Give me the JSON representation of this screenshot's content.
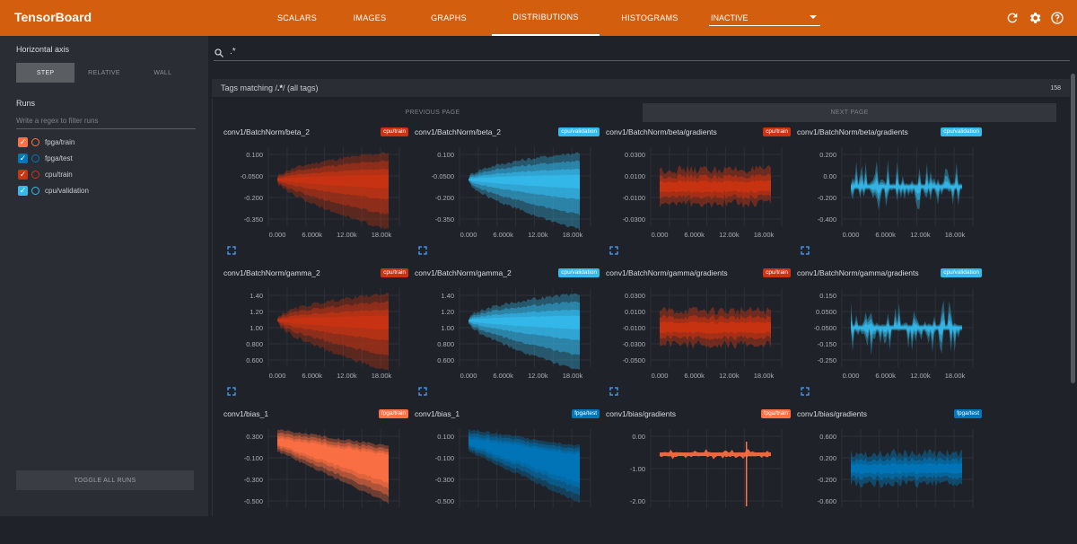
{
  "brand": "TensorBoard",
  "tabs": [
    {
      "label": "SCALARS",
      "active": false
    },
    {
      "label": "IMAGES",
      "active": false
    },
    {
      "label": "GRAPHS",
      "active": false
    },
    {
      "label": "DISTRIBUTIONS",
      "active": true
    },
    {
      "label": "HISTOGRAMS",
      "active": false
    }
  ],
  "inactive_select": "INACTIVE",
  "icons": {
    "refresh": "refresh-icon",
    "settings": "gear-icon",
    "help": "help-icon"
  },
  "sidebar": {
    "horizontal_axis_title": "Horizontal axis",
    "axis_options": [
      {
        "label": "STEP",
        "active": true
      },
      {
        "label": "RELATIVE",
        "active": false
      },
      {
        "label": "WALL",
        "active": false
      }
    ],
    "runs_title": "Runs",
    "filter_placeholder": "Write a regex to filter runs",
    "runs": [
      {
        "name": "fpga/train",
        "color": "#ff7043"
      },
      {
        "name": "fpga/test",
        "color": "#0077bb"
      },
      {
        "name": "cpu/train",
        "color": "#cc3311"
      },
      {
        "name": "cpu/validation",
        "color": "#33bbee"
      }
    ],
    "toggle_all": "TOGGLE ALL RUNS"
  },
  "search": {
    "value": ".*"
  },
  "tags": {
    "label_prefix": "Tags matching /",
    "regex": ".*",
    "label_suffix": "/ (all tags)",
    "count": "158"
  },
  "pager": {
    "previous": "PREVIOUS PAGE",
    "next": "NEXT PAGE"
  },
  "colors": {
    "cpu_train": "#cc3311",
    "cpu_validation": "#33bbee",
    "fpga_train": "#ff7043",
    "fpga_test": "#0077bb"
  },
  "cards": [
    {
      "title": "conv1/BatchNorm/beta_2",
      "run": "cpu/train",
      "color": "#cc3311",
      "kind": "fan",
      "yticks": [
        "0.100",
        "-0.0500",
        "-0.200",
        "-0.350"
      ],
      "xticks": [
        "0.000",
        "6.000k",
        "12.00k",
        "18.00k"
      ]
    },
    {
      "title": "conv1/BatchNorm/beta_2",
      "run": "cpu/validation",
      "color": "#33bbee",
      "kind": "fan",
      "yticks": [
        "0.100",
        "-0.0500",
        "-0.200",
        "-0.350"
      ],
      "xticks": [
        "0.000",
        "6.000k",
        "12.00k",
        "18.00k"
      ]
    },
    {
      "title": "conv1/BatchNorm/beta/gradients",
      "run": "cpu/train",
      "color": "#cc3311",
      "kind": "noise",
      "yticks": [
        "0.0300",
        "0.0100",
        "-0.0100",
        "-0.0300"
      ],
      "xticks": [
        "0.000",
        "6.000k",
        "12.00k",
        "18.00k"
      ]
    },
    {
      "title": "conv1/BatchNorm/beta/gradients",
      "run": "cpu/validation",
      "color": "#33bbee",
      "kind": "spiky",
      "yticks": [
        "0.200",
        "0.00",
        "-0.200",
        "-0.400"
      ],
      "xticks": [
        "0.000",
        "6.000k",
        "12.00k",
        "18.00k"
      ]
    },
    {
      "title": "conv1/BatchNorm/gamma_2",
      "run": "cpu/train",
      "color": "#cc3311",
      "kind": "fan",
      "yticks": [
        "1.40",
        "1.20",
        "1.00",
        "0.800",
        "0.600"
      ],
      "xticks": [
        "0.000",
        "6.000k",
        "12.00k",
        "18.00k"
      ]
    },
    {
      "title": "conv1/BatchNorm/gamma_2",
      "run": "cpu/validation",
      "color": "#33bbee",
      "kind": "fan",
      "yticks": [
        "1.40",
        "1.20",
        "1.00",
        "0.800",
        "0.600"
      ],
      "xticks": [
        "0.000",
        "6.000k",
        "12.00k",
        "18.00k"
      ]
    },
    {
      "title": "conv1/BatchNorm/gamma/gradients",
      "run": "cpu/train",
      "color": "#cc3311",
      "kind": "noise",
      "yticks": [
        "0.0300",
        "0.0100",
        "-0.0100",
        "-0.0300",
        "-0.0500"
      ],
      "xticks": [
        "0.000",
        "6.000k",
        "12.00k",
        "18.00k"
      ]
    },
    {
      "title": "conv1/BatchNorm/gamma/gradients",
      "run": "cpu/validation",
      "color": "#33bbee",
      "kind": "spiky",
      "yticks": [
        "0.150",
        "0.0500",
        "-0.0500",
        "-0.150",
        "-0.250"
      ],
      "xticks": [
        "0.000",
        "6.000k",
        "12.00k",
        "18.00k"
      ]
    },
    {
      "title": "conv1/bias_1",
      "run": "fpga/train",
      "color": "#ff7043",
      "kind": "down",
      "yticks": [
        "0.300",
        "-0.100",
        "-0.300",
        "-0.500"
      ],
      "xticks": []
    },
    {
      "title": "conv1/bias_1",
      "run": "fpga/test",
      "color": "#0077bb",
      "kind": "down",
      "yticks": [
        "0.100",
        "-0.100",
        "-0.300",
        "-0.500"
      ],
      "xticks": []
    },
    {
      "title": "conv1/bias/gradients",
      "run": "fpga/train",
      "color": "#ff7043",
      "kind": "flatspike",
      "yticks": [
        "0.00",
        "-1.00",
        "-2.00"
      ],
      "xticks": []
    },
    {
      "title": "conv1/bias/gradients",
      "run": "fpga/test",
      "color": "#0077bb",
      "kind": "noisewide",
      "yticks": [
        "0.600",
        "0.200",
        "-0.200",
        "-0.600"
      ],
      "xticks": []
    }
  ]
}
